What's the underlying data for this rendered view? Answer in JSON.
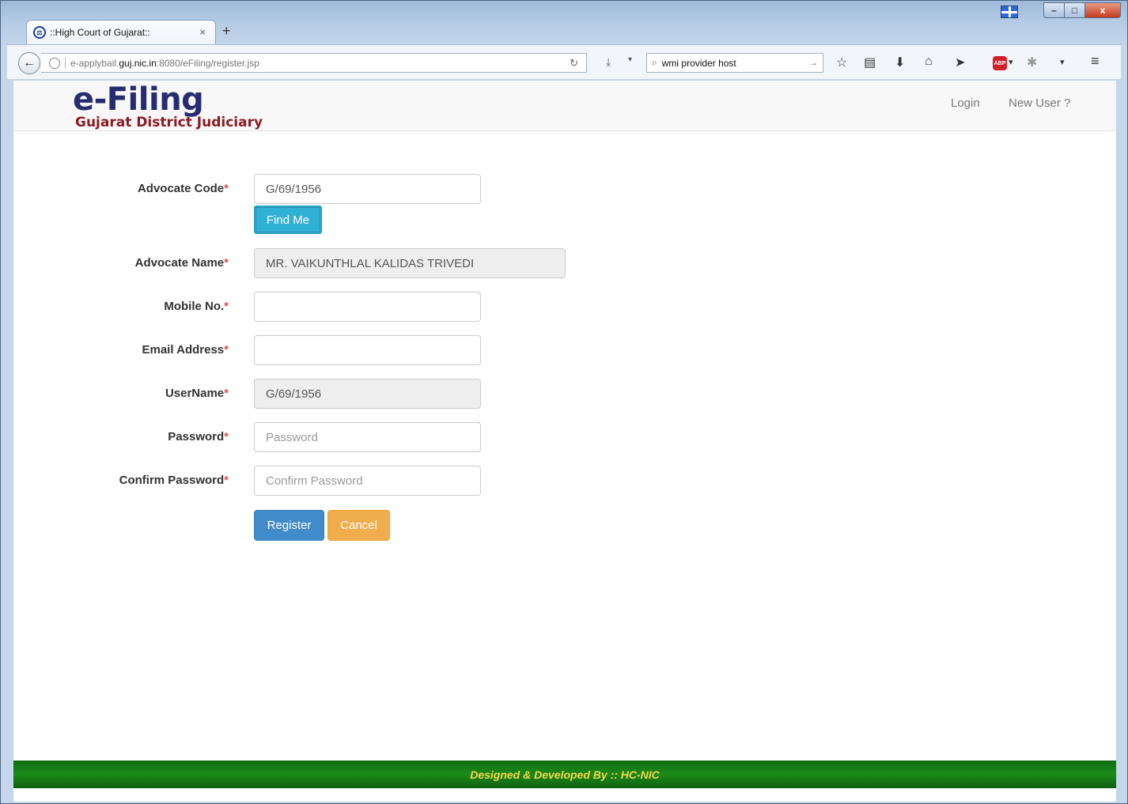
{
  "browser": {
    "tab_title": "::High Court of Gujarat::",
    "tab_close": "×",
    "new_tab": "+",
    "url_prefix": "e-applybail.",
    "url_host": "guj.nic.in",
    "url_suffix": ":8080/eFiling/register.jsp",
    "search_value": "wmi provider host",
    "controls": {
      "minimize": "–",
      "maximize": "□",
      "close": "x"
    }
  },
  "site": {
    "logo_title": "e-Filing",
    "logo_subtitle": "Gujarat District Judiciary",
    "nav": {
      "login": "Login",
      "new_user": "New User ?"
    }
  },
  "form": {
    "advocate_code": {
      "label": "Advocate Code",
      "value": "G/69/1956"
    },
    "find_me": "Find Me",
    "advocate_name": {
      "label": "Advocate Name",
      "value": "MR. VAIKUNTHLAL KALIDAS TRIVEDI"
    },
    "mobile": {
      "label": "Mobile No.",
      "value": ""
    },
    "email": {
      "label": "Email Address",
      "value": ""
    },
    "username": {
      "label": "UserName",
      "value": "G/69/1956"
    },
    "password": {
      "label": "Password",
      "placeholder": "Password"
    },
    "confirm_password": {
      "label": "Confirm Password",
      "placeholder": "Confirm Password"
    },
    "required_mark": "*",
    "register": "Register",
    "cancel": "Cancel"
  },
  "footer": {
    "text": "Designed & Developed By :: HC-NIC"
  },
  "colors": {
    "logo_blue": "#262c6f",
    "logo_red": "#8b1a23",
    "info": "#31b0d5",
    "primary": "#428bca",
    "warning": "#f0ad4e",
    "footer_green": "#1c8a1a",
    "footer_text": "#f5d54a"
  }
}
